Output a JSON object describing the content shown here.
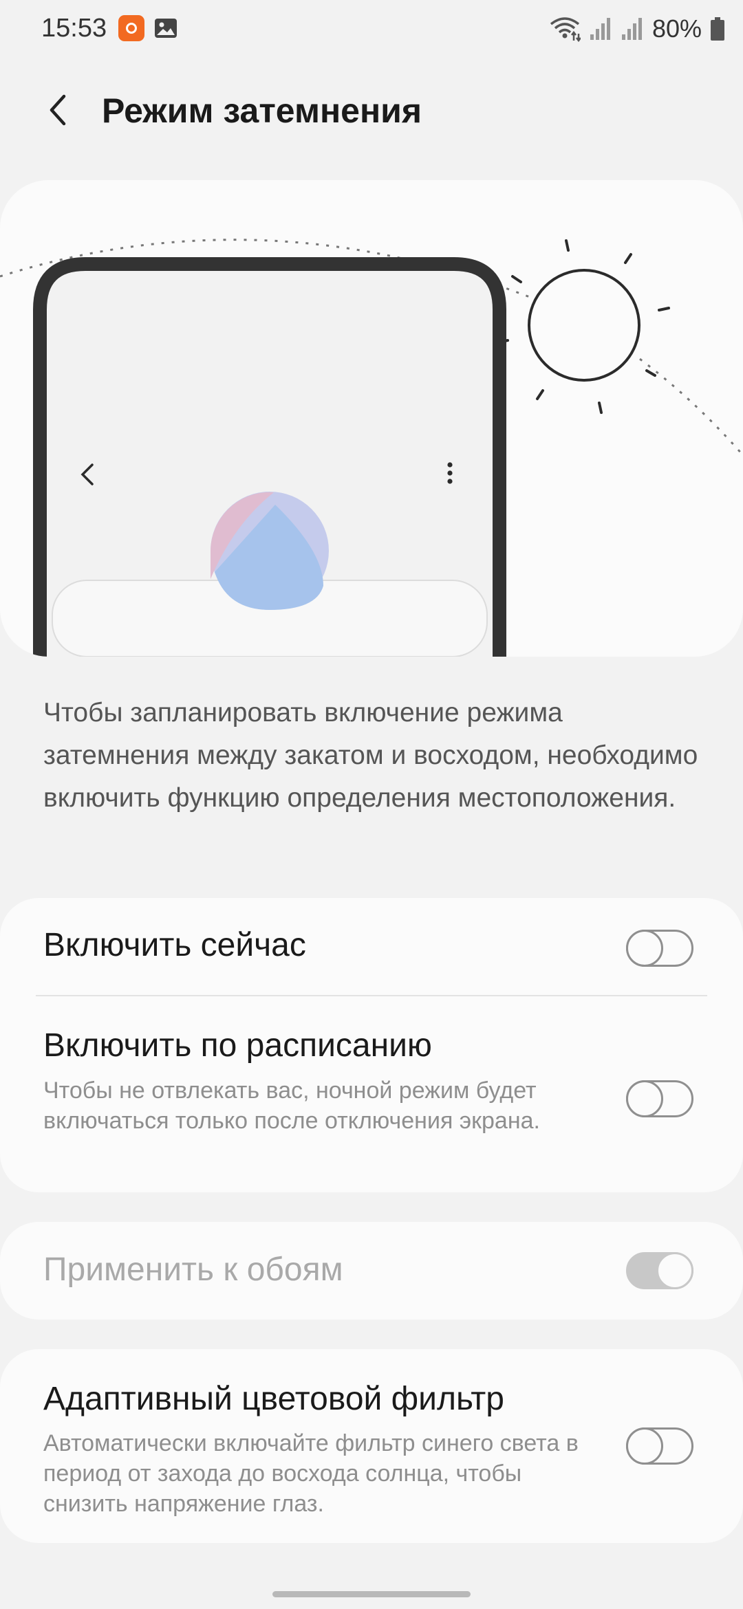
{
  "status_bar": {
    "time": "15:53",
    "battery": "80%",
    "icons": [
      "app-notification-icon",
      "gallery-icon",
      "wifi-icon",
      "signal-icon",
      "signal-icon",
      "battery-icon"
    ]
  },
  "header": {
    "back_icon": "back-arrow-icon",
    "title": "Режим затемнения"
  },
  "description": "Чтобы запланировать включение режима затемнения между закатом и восходом, необходимо включить функцию определения местоположения.",
  "settings": {
    "enable_now": {
      "title": "Включить сейчас",
      "state": "off"
    },
    "schedule": {
      "title": "Включить по расписанию",
      "description": "Чтобы не отвлекать вас, ночной режим будет включаться только после отключения экрана.",
      "state": "off"
    },
    "wallpaper": {
      "title": "Применить к обоям",
      "state": "on",
      "enabled": false
    },
    "adaptive_filter": {
      "title": "Адаптивный цветовой фильтр",
      "description": "Автоматически включайте фильтр синего света в период от захода до восхода солнца, чтобы снизить напряжение глаз.",
      "state": "off"
    }
  },
  "colors": {
    "background": "#f2f2f2",
    "card": "#fbfbfb",
    "notification_app": "#f26a21",
    "illustration_pink": "#e0bcd0",
    "illustration_blue": "#a6c3ec"
  }
}
